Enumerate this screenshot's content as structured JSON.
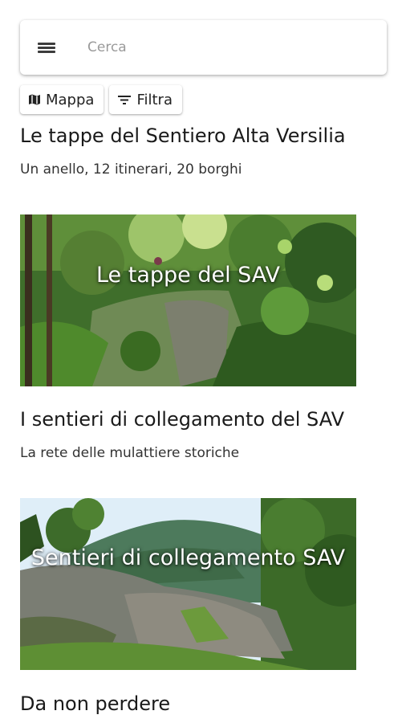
{
  "search": {
    "placeholder": "Cerca",
    "menu_icon": "hamburger-menu-icon"
  },
  "chips": [
    {
      "label": "Mappa",
      "icon": "map-icon"
    },
    {
      "label": "Filtra",
      "icon": "filter-icon"
    }
  ],
  "sections": [
    {
      "title": "Le tappe del Sentiero Alta Versilia",
      "subtitle": "Un anello, 12 itinerari, 20 borghi",
      "card_label": "Le tappe del SAV"
    },
    {
      "title": "I sentieri di collegamento del SAV",
      "subtitle": "La rete delle mulattiere storiche",
      "card_label": "Sentieri di collegamento SAV"
    },
    {
      "title": "Da non perdere"
    }
  ],
  "colors": {
    "card_text": "#ffffff",
    "forest_green": "#3d6b2a",
    "sky": "#dfeef8"
  }
}
